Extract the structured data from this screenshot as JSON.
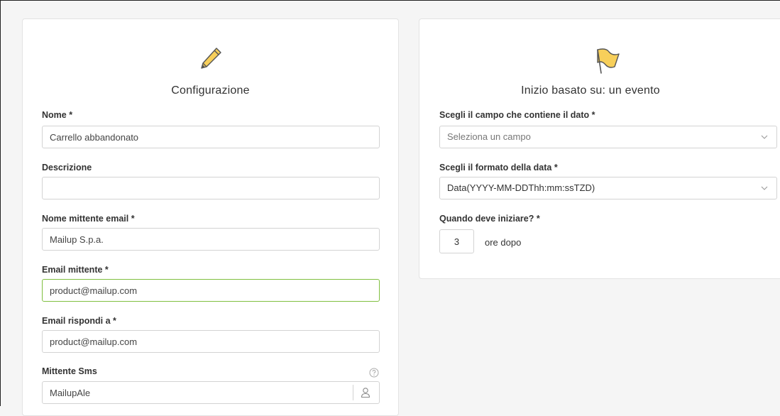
{
  "config": {
    "title": "Configurazione",
    "icon": "pencil-icon",
    "fields": {
      "name": {
        "label": "Nome *",
        "value": "Carrello abbandonato",
        "placeholder": ""
      },
      "description": {
        "label": "Descrizione",
        "value": "",
        "placeholder": ""
      },
      "sender_name": {
        "label": "Nome mittente email *",
        "value": "Mailup S.p.a.",
        "placeholder": ""
      },
      "sender_email": {
        "label": "Email mittente *",
        "value": "product@mailup.com",
        "placeholder": ""
      },
      "reply_to": {
        "label": "Email rispondi a *",
        "value": "product@mailup.com",
        "placeholder": ""
      },
      "sms_sender": {
        "label": "Mittente Sms",
        "value": "MailupAle",
        "placeholder": ""
      }
    }
  },
  "trigger": {
    "title": "Inizio basato su: un evento",
    "icon": "flag-icon",
    "field_select": {
      "label": "Scegli il campo che contiene il dato *",
      "placeholder": "Seleziona un campo"
    },
    "date_format": {
      "label": "Scegli il formato della data *",
      "value": "Data(YYYY-MM-DDThh:mm:ssTZD)"
    },
    "start": {
      "label": "Quando deve iniziare? *",
      "value": "3",
      "suffix": "ore dopo"
    }
  },
  "colors": {
    "background": "#f5f5f5",
    "card": "#ffffff",
    "valid_border": "#7fbf3f",
    "icon_yellow": "#f7cf5a"
  }
}
